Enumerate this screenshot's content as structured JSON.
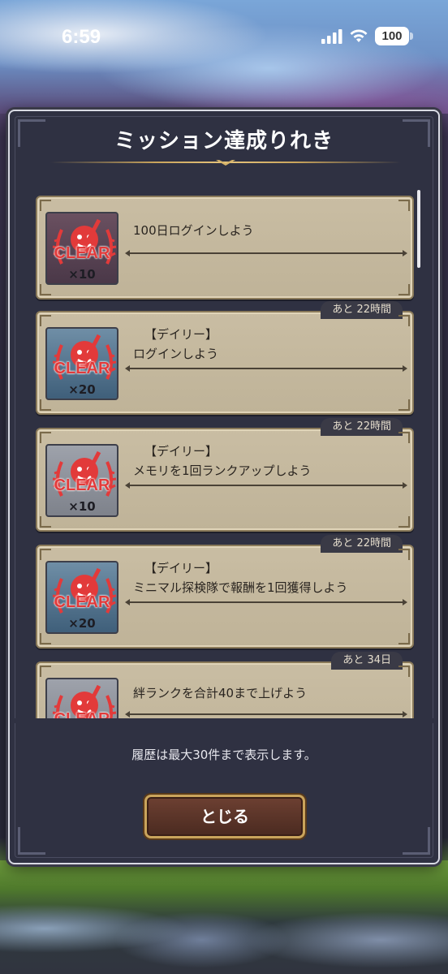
{
  "status_bar": {
    "time": "6:59",
    "battery": "100"
  },
  "dialog": {
    "title": "ミッション達成りれき",
    "footer_note": "履歴は最大30件まで表示します。",
    "close_label": "とじる"
  },
  "missions": [
    {
      "tag": "",
      "text": "100日ログインしよう",
      "time_left": "",
      "reward_qty": "×10",
      "clear_label": "CLEAR",
      "reward_theme": "dark"
    },
    {
      "tag": "【デイリー】",
      "text": "ログインしよう",
      "time_left": "あと 22時間",
      "reward_qty": "×20",
      "clear_label": "CLEAR",
      "reward_theme": "blue"
    },
    {
      "tag": "【デイリー】",
      "text": "メモリを1回ランクアップしよう",
      "time_left": "あと 22時間",
      "reward_qty": "×10",
      "clear_label": "CLEAR",
      "reward_theme": "gray"
    },
    {
      "tag": "【デイリー】",
      "text": "ミニマル探検隊で報酬を1回獲得しよう",
      "time_left": "あと 22時間",
      "reward_qty": "×20",
      "clear_label": "CLEAR",
      "reward_theme": "blue"
    },
    {
      "tag": "",
      "text": "絆ランクを合計40まで上げよう",
      "time_left": "あと 34日",
      "reward_qty": "",
      "clear_label": "CLEAR",
      "reward_theme": "gray"
    }
  ],
  "colors": {
    "dialog_bg": "#2f3142",
    "card_bg": "#c9bda3",
    "gold": "#c9a45c",
    "stamp_red": "#e23a3a"
  }
}
